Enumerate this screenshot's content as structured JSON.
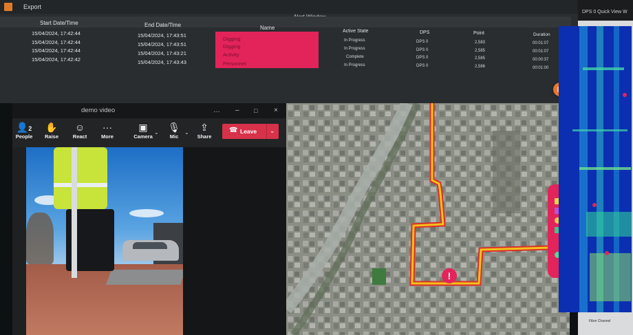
{
  "alert_window": {
    "export_label": "Export",
    "title": "Alert Window",
    "controls": {
      "minimize": "–",
      "maximize": "□",
      "close": "×"
    },
    "columns": {
      "start": "Start Date/Time",
      "end": "End Date/Time",
      "name": "Name",
      "state": "Active State",
      "dps": "DPS",
      "point": "Point",
      "duration": "Duration"
    },
    "rows": [
      {
        "start": "15/04/2024, 17:42:44",
        "end": "15/04/2024, 17:43:51",
        "name": "Digging",
        "state": "In Progress",
        "dps": "DPS 0",
        "point": "2,583",
        "duration": "00:01:07"
      },
      {
        "start": "15/04/2024, 17:42:44",
        "end": "15/04/2024, 17:43:51",
        "name": "Digging",
        "state": "In Progress",
        "dps": "DPS 0",
        "point": "2,585",
        "duration": "00:01:07"
      },
      {
        "start": "15/04/2024, 17:42:44",
        "end": "15/04/2024, 17:43:21",
        "name": "Activity",
        "state": "Complete",
        "dps": "DPS 0",
        "point": "2,585",
        "duration": "00:00:37"
      },
      {
        "start": "15/04/2024, 17:42:42",
        "end": "15/04/2024, 17:43:43",
        "name": "Personnel",
        "state": "In Progress",
        "dps": "DPS 0",
        "point": "2,586",
        "duration": "00:01:00"
      }
    ],
    "name_highlight_color": "#e2245a"
  },
  "video_window": {
    "title": "demo video",
    "controls": {
      "more": "…",
      "minimize": "–",
      "maximize": "□",
      "close": "×"
    },
    "toolbar": {
      "people": {
        "label": "People",
        "count": "2"
      },
      "raise": "Raise",
      "react": "React",
      "more": "More",
      "camera": "Camera",
      "mic": "Mic",
      "share": "Share",
      "leave": "Leave"
    },
    "leave_color": "#d8324a"
  },
  "map": {
    "route_color": "#f3c21a",
    "alert_pin": "!"
  },
  "dps_panel": {
    "title": "DPS 0 Quick View W",
    "x_label": "Fibre Channel"
  }
}
